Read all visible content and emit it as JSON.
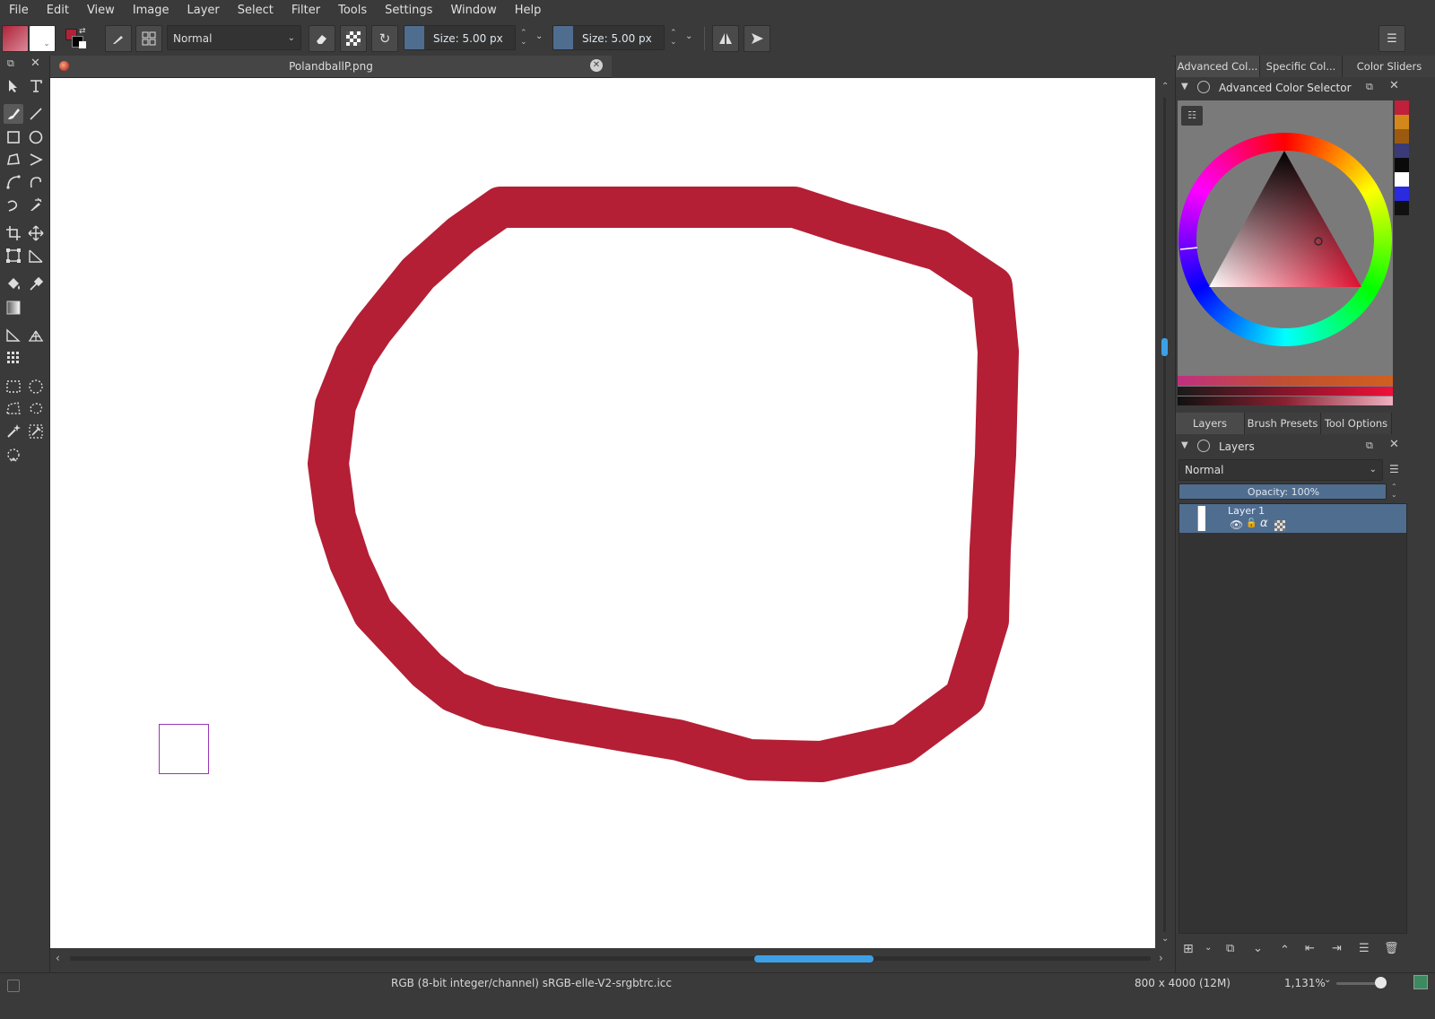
{
  "menubar": [
    "File",
    "Edit",
    "View",
    "Image",
    "Layer",
    "Select",
    "Filter",
    "Tools",
    "Settings",
    "Window",
    "Help"
  ],
  "toolbar": {
    "blend_mode": "Normal",
    "size1_label": "Size:  5.00 px",
    "size2_label": "Size:  5.00 px",
    "fg_color": "#b02238",
    "bg_color": "#ffffff"
  },
  "document": {
    "tab_title": "PolandballP.png",
    "stroke_color": "#b41f35"
  },
  "docker": {
    "top_tabs": [
      "Advanced Col...",
      "Specific Col...",
      "Color Sliders"
    ],
    "color_selector_title": "Advanced Color Selector",
    "bottom_tabs": [
      "Layers",
      "Brush Presets",
      "Tool Options"
    ],
    "layers_title": "Layers",
    "layer_blend_mode": "Normal",
    "opacity_label": "Opacity:  100%",
    "opacity_value": 100,
    "layers": [
      {
        "name": "Layer 1",
        "selected": true
      }
    ]
  },
  "swatches": [
    "#c0203a",
    "#d4881a",
    "#9b5a10",
    "#3a3a78",
    "#0a0a0a",
    "#ffffff",
    "#2a2ae0",
    "#111111"
  ],
  "statusbar": {
    "color_info": "RGB (8-bit integer/channel)  sRGB-elle-V2-srgbtrc.icc",
    "image_size": "800 x 4000 (12M)",
    "zoom": "1,131%"
  }
}
